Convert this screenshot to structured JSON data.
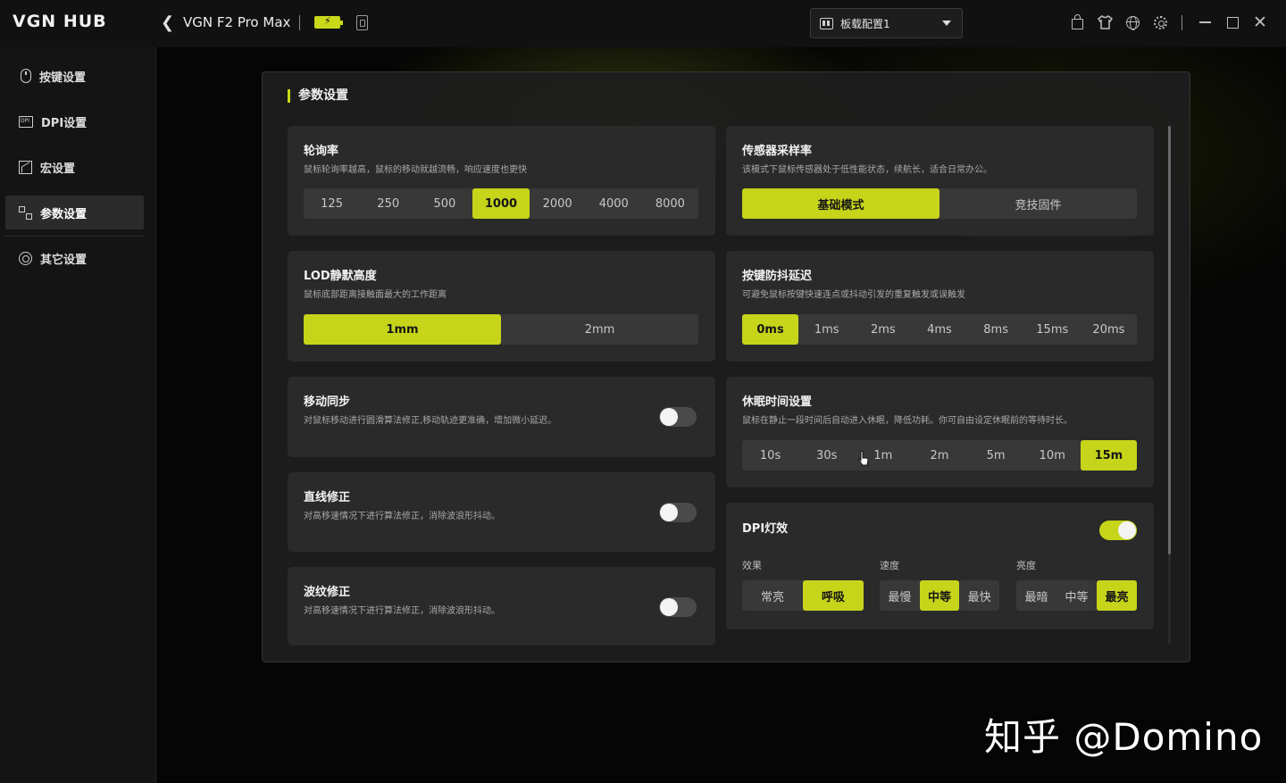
{
  "app": {
    "logo": "VGN HUB",
    "device_name": "VGN F2 Pro Max",
    "config_selected": "板载配置1",
    "accent": "#c6d51a"
  },
  "sidebar": {
    "items": [
      {
        "label": "按键设置",
        "icon": "mouse-icon"
      },
      {
        "label": "DPI设置",
        "icon": "dpi-icon"
      },
      {
        "label": "宏设置",
        "icon": "macro-icon"
      },
      {
        "label": "参数设置",
        "icon": "params-icon",
        "active": true
      },
      {
        "label": "其它设置",
        "icon": "other-icon"
      }
    ]
  },
  "panel": {
    "title": "参数设置",
    "polling": {
      "title": "轮询率",
      "desc": "鼠标轮询率越高，鼠标的移动就越流畅，响应速度也更快",
      "options": [
        "125",
        "250",
        "500",
        "1000",
        "2000",
        "4000",
        "8000"
      ],
      "selected": "1000"
    },
    "sensor": {
      "title": "传感器采样率",
      "desc": "该模式下鼠标传感器处于低性能状态，续航长，适合日常办公。",
      "options": [
        "基础模式",
        "竞技固件"
      ],
      "selected": "基础模式"
    },
    "lod": {
      "title": "LOD静默高度",
      "desc": "鼠标底部距离接触面最大的工作距离",
      "options": [
        "1mm",
        "2mm"
      ],
      "selected": "1mm"
    },
    "debounce": {
      "title": "按键防抖延迟",
      "desc": "可避免鼠标按键快速连点或抖动引发的重复触发或误触发",
      "options": [
        "0ms",
        "1ms",
        "2ms",
        "4ms",
        "8ms",
        "15ms",
        "20ms"
      ],
      "selected": "0ms"
    },
    "motion_sync": {
      "title": "移动同步",
      "desc": "对鼠标移动进行圆滑算法修正,移动轨迹更准确，增加微小延迟。",
      "on": false
    },
    "sleep": {
      "title": "休眠时间设置",
      "desc": "鼠标在静止一段时间后自动进入休眠，降低功耗。你可自由设定休眠前的等待时长。",
      "options": [
        "10s",
        "30s",
        "1m",
        "2m",
        "5m",
        "10m",
        "15m"
      ],
      "selected": "15m"
    },
    "angle_snap": {
      "title": "直线修正",
      "desc": "对高移速情况下进行算法修正，消除波浪形抖动。",
      "on": false
    },
    "ripple": {
      "title": "波纹修正",
      "desc": "对高移速情况下进行算法修正，消除波浪形抖动。",
      "on": false
    },
    "dpi_light": {
      "title": "DPI灯效",
      "on": true,
      "effect_label": "效果",
      "effect_options": [
        "常亮",
        "呼吸"
      ],
      "effect_selected": "呼吸",
      "speed_label": "速度",
      "speed_options": [
        "最慢",
        "中等",
        "最快"
      ],
      "speed_selected": "中等",
      "brightness_label": "亮度",
      "brightness_options": [
        "最暗",
        "中等",
        "最亮"
      ],
      "brightness_selected": "最亮"
    }
  },
  "watermark": "知乎 @Domino"
}
